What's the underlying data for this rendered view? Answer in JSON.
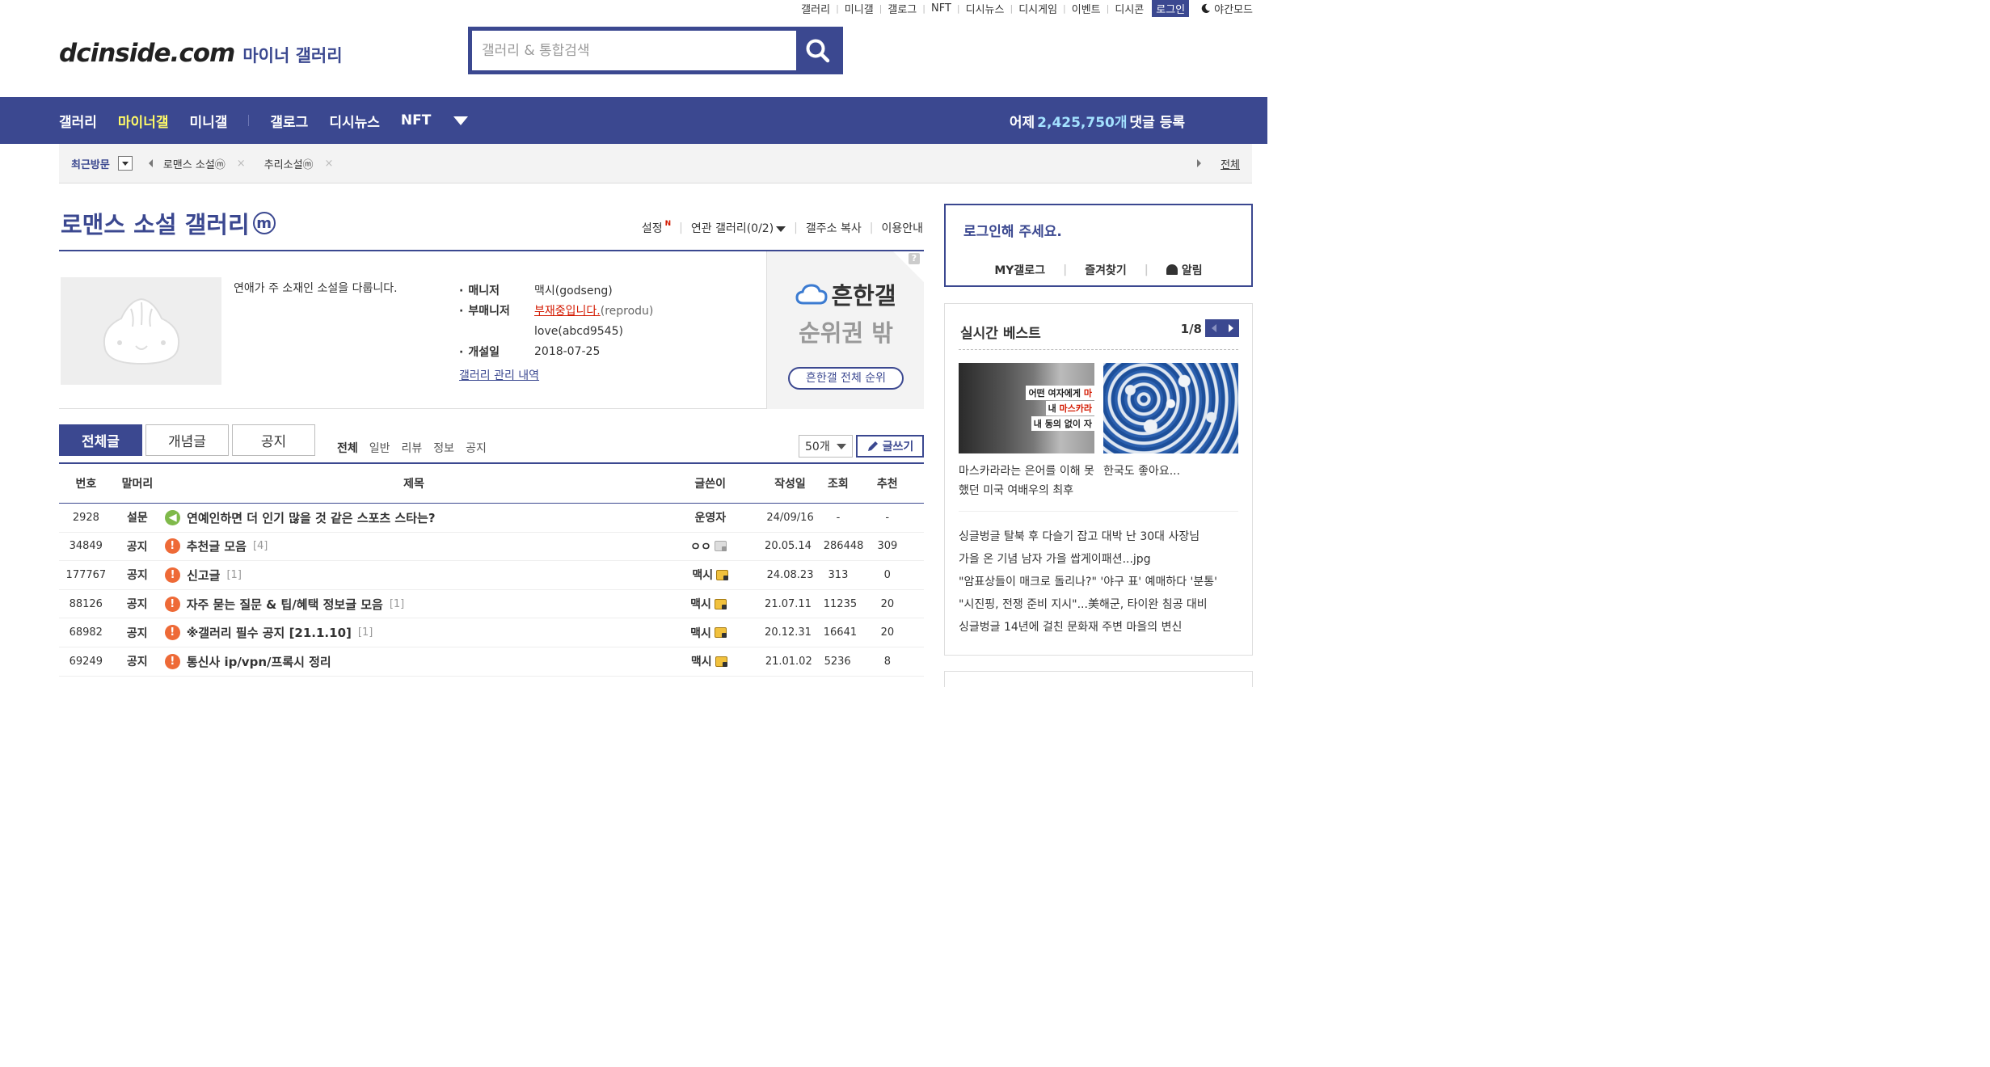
{
  "util": {
    "links": [
      "갤러리",
      "미니갤",
      "갤로그",
      "NFT",
      "디시뉴스",
      "디시게임",
      "이벤트",
      "디시콘"
    ],
    "login": "로그인",
    "night": "야간모드"
  },
  "header": {
    "brand": "dcinside.com",
    "sub": "마이너 갤러리",
    "search_placeholder": "갤러리 & 통합검색"
  },
  "nav": {
    "items": [
      "갤러리",
      "마이너갤",
      "미니갤",
      "갤로그",
      "디시뉴스",
      "NFT"
    ],
    "count_prefix": "어제",
    "count_value": "2,425,750개",
    "count_suffix": "댓글 등록"
  },
  "recent": {
    "label": "최근방문",
    "items": [
      "로맨스 소설ⓜ",
      "추리소설ⓜ"
    ],
    "all": "전체"
  },
  "gallery": {
    "title": "로맨스 소설 갤러리",
    "badge": "m",
    "menu": {
      "settings": "설정",
      "new": "N",
      "related": "연관 갤러리(0/2)",
      "copy": "갤주소 복사",
      "guide": "이용안내"
    },
    "description": "연애가 주 소재인 소설을 다룹니다.",
    "manager_label": "매니저",
    "manager": "맥시(godseng)",
    "submanager_label": "부매니저",
    "submanager_away": "부재중입니다.",
    "submanager_away_id": "(reprodu)",
    "submanager2": "love(abcd9545)",
    "founded_label": "개설일",
    "founded": "2018-07-25",
    "history_link": "갤러리 관리 내역",
    "rank_line1": "흔한갤",
    "rank_line2": "순위권 밖",
    "rank_button": "흔한갤 전체 순위",
    "rank_help": "?"
  },
  "tabs": {
    "main": [
      "전체글",
      "개념글",
      "공지"
    ],
    "sub": [
      "전체",
      "일반",
      "리뷰",
      "정보",
      "공지"
    ],
    "per_page": "50개",
    "write": "글쓰기"
  },
  "table": {
    "headers": {
      "num": "번호",
      "head": "말머리",
      "title": "제목",
      "writer": "글쓴이",
      "date": "작성일",
      "views": "조회",
      "rec": "추천"
    },
    "rows": [
      {
        "num": "2928",
        "head": "설문",
        "title": "연예인하면 더 인기 많을 것 같은 스포츠 스타는?",
        "count": "",
        "writer": "운영자",
        "date": "24/09/16",
        "views": "-",
        "rec": "-"
      },
      {
        "num": "34849",
        "head": "공지",
        "title": "추천글 모음",
        "count": "[4]",
        "writer": "ㅇㅇ",
        "date": "20.05.14",
        "views": "286448",
        "rec": "309"
      },
      {
        "num": "177767",
        "head": "공지",
        "title": "신고글",
        "count": "[1]",
        "writer": "맥시",
        "date": "24.08.23",
        "views": "313",
        "rec": "0"
      },
      {
        "num": "88126",
        "head": "공지",
        "title": "자주 묻는 질문 & 팁/혜택 정보글 모음",
        "count": "[1]",
        "writer": "맥시",
        "date": "21.07.11",
        "views": "11235",
        "rec": "20"
      },
      {
        "num": "68982",
        "head": "공지",
        "title": "※갤러리 필수 공지 [21.1.10]",
        "count": "[1]",
        "writer": "맥시",
        "date": "20.12.31",
        "views": "16641",
        "rec": "20"
      },
      {
        "num": "69249",
        "head": "공지",
        "title": "통신사 ip/vpn/프록시 정리",
        "count": "",
        "writer": "맥시",
        "date": "21.01.02",
        "views": "5236",
        "rec": "8"
      }
    ]
  },
  "login_box": {
    "title": "로그인해 주세요.",
    "links": [
      "MY갤로그",
      "즐겨찾기",
      "알림"
    ]
  },
  "best": {
    "title": "실시간 베스트",
    "page": "1/8",
    "img1_cap1a": "어떤 여자에게 ",
    "img1_cap1b": "마",
    "img1_cap2a": "내 ",
    "img1_cap2b": "마스카라",
    "img1_cap3": "내 동의 없이 자",
    "card1": "마스카라라는 은어를 이해 못했던 미국 여배우의 최후",
    "card2": "한국도 좋아요...",
    "list": [
      "싱글벙글 탈북 후 다슬기 잡고 대박 난 30대 사장님",
      "가을 온 기념 남자 가을 쌉게이패션...jpg",
      "\"암표상들이 매크로 돌리나?\" '야구 표' 예매하다 '분통'",
      "\"시진핑, 전쟁 준비 지시\"...美해군, 타이완 침공 대비",
      "싱글벙글 14년에 걸친 문화재 주변 마을의 변신"
    ]
  }
}
